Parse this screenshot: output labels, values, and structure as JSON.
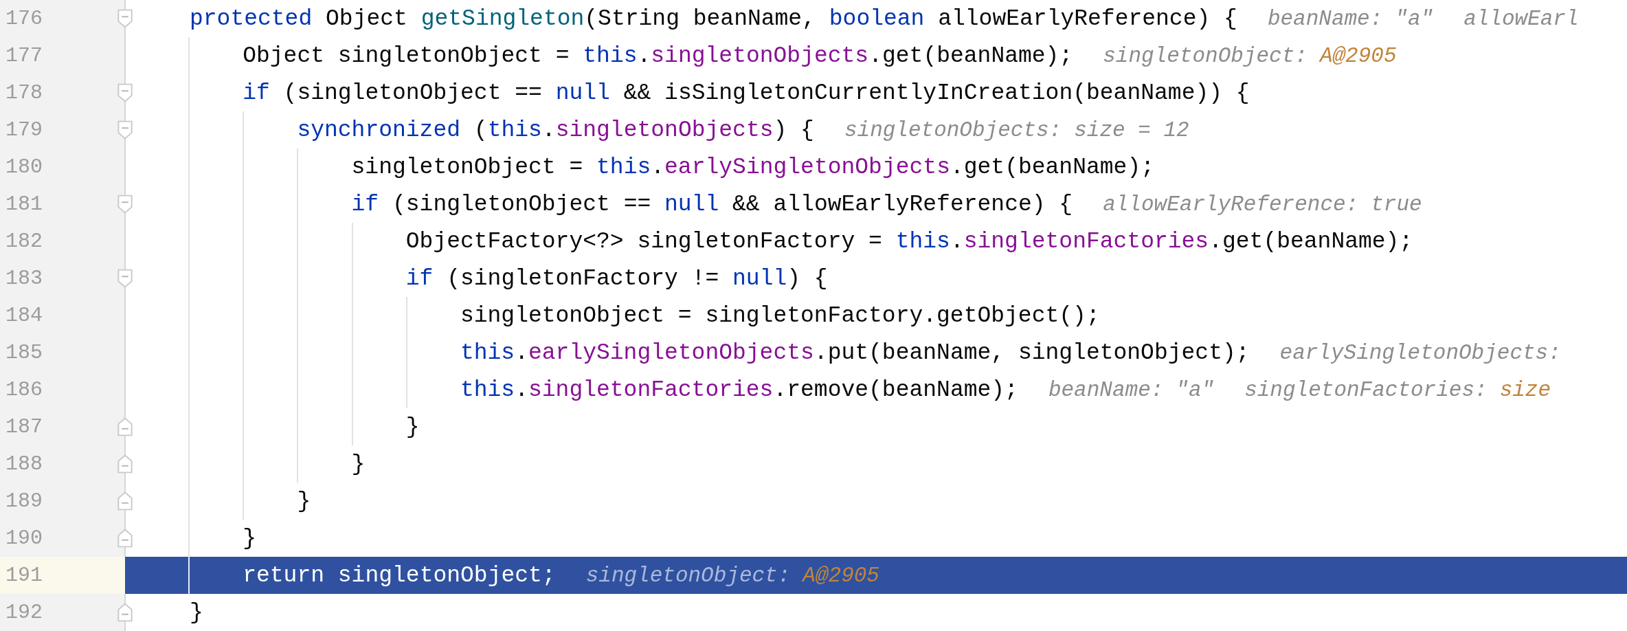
{
  "lines": [
    {
      "number": "176",
      "kind": "block-start",
      "selected": false,
      "tokens": [
        {
          "kind": "keyword",
          "text": "protected"
        },
        {
          "kind": "plain",
          "text": " Object "
        },
        {
          "kind": "method",
          "text": "getSingleton"
        },
        {
          "kind": "plain",
          "text": "(String beanName, "
        },
        {
          "kind": "keyword",
          "text": "boolean"
        },
        {
          "kind": "plain",
          "text": " allowEarlyReference) {"
        }
      ],
      "hints": [
        {
          "label": "beanName:",
          "value": "\"a\"",
          "kind": "plain"
        },
        {
          "label": "allowEarl"
        }
      ],
      "children": [
        {
          "number": "177",
          "kind": "line",
          "selected": false,
          "tokens": [
            {
              "kind": "plain",
              "text": "Object singletonObject = "
            },
            {
              "kind": "keyword",
              "text": "this"
            },
            {
              "kind": "plain",
              "text": "."
            },
            {
              "kind": "field",
              "text": "singletonObjects"
            },
            {
              "kind": "plain",
              "text": ".get(beanName);"
            }
          ],
          "hints": [
            {
              "label": "singletonObject:",
              "value": "A@2905",
              "kind": "object"
            }
          ]
        },
        {
          "number": "178",
          "kind": "block-start",
          "selected": false,
          "tokens": [
            {
              "kind": "keyword",
              "text": "if"
            },
            {
              "kind": "plain",
              "text": " (singletonObject == "
            },
            {
              "kind": "keyword",
              "text": "null"
            },
            {
              "kind": "plain",
              "text": " && isSingletonCurrentlyInCreation(beanName)) {"
            }
          ],
          "children": [
            {
              "number": "179",
              "kind": "block-start",
              "selected": false,
              "tokens": [
                {
                  "kind": "keyword",
                  "text": "synchronized"
                },
                {
                  "kind": "plain",
                  "text": " ("
                },
                {
                  "kind": "keyword",
                  "text": "this"
                },
                {
                  "kind": "plain",
                  "text": "."
                },
                {
                  "kind": "field",
                  "text": "singletonObjects"
                },
                {
                  "kind": "plain",
                  "text": ") {"
                }
              ],
              "hints": [
                {
                  "label": "singletonObjects:",
                  "value": "size = 12",
                  "kind": "plain"
                }
              ],
              "children": [
                {
                  "number": "180",
                  "kind": "line",
                  "selected": false,
                  "tokens": [
                    {
                      "kind": "plain",
                      "text": "singletonObject = "
                    },
                    {
                      "kind": "keyword",
                      "text": "this"
                    },
                    {
                      "kind": "plain",
                      "text": "."
                    },
                    {
                      "kind": "field",
                      "text": "earlySingletonObjects"
                    },
                    {
                      "kind": "plain",
                      "text": ".get(beanName);"
                    }
                  ]
                },
                {
                  "number": "181",
                  "kind": "block-start",
                  "selected": false,
                  "tokens": [
                    {
                      "kind": "keyword",
                      "text": "if"
                    },
                    {
                      "kind": "plain",
                      "text": " (singletonObject == "
                    },
                    {
                      "kind": "keyword",
                      "text": "null"
                    },
                    {
                      "kind": "plain",
                      "text": " && allowEarlyReference) {"
                    }
                  ],
                  "hints": [
                    {
                      "label": "allowEarlyReference:",
                      "value": "true",
                      "kind": "plain"
                    }
                  ],
                  "children": [
                    {
                      "number": "182",
                      "kind": "line",
                      "selected": false,
                      "tokens": [
                        {
                          "kind": "plain",
                          "text": "ObjectFactory<?> singletonFactory = "
                        },
                        {
                          "kind": "keyword",
                          "text": "this"
                        },
                        {
                          "kind": "plain",
                          "text": "."
                        },
                        {
                          "kind": "field",
                          "text": "singletonFactories"
                        },
                        {
                          "kind": "plain",
                          "text": ".get(beanName);"
                        }
                      ]
                    },
                    {
                      "number": "183",
                      "kind": "block-start",
                      "selected": false,
                      "tokens": [
                        {
                          "kind": "keyword",
                          "text": "if"
                        },
                        {
                          "kind": "plain",
                          "text": " (singletonFactory != "
                        },
                        {
                          "kind": "keyword",
                          "text": "null"
                        },
                        {
                          "kind": "plain",
                          "text": ") {"
                        }
                      ],
                      "children": [
                        {
                          "number": "184",
                          "kind": "line",
                          "selected": false,
                          "tokens": [
                            {
                              "kind": "plain",
                              "text": "singletonObject = singletonFactory.getObject();"
                            }
                          ]
                        },
                        {
                          "number": "185",
                          "kind": "line",
                          "selected": false,
                          "tokens": [
                            {
                              "kind": "keyword",
                              "text": "this"
                            },
                            {
                              "kind": "plain",
                              "text": "."
                            },
                            {
                              "kind": "field",
                              "text": "earlySingletonObjects"
                            },
                            {
                              "kind": "plain",
                              "text": ".put(beanName, singletonObject);"
                            }
                          ],
                          "hints": [
                            {
                              "label": "earlySingletonObjects:"
                            }
                          ]
                        },
                        {
                          "number": "186",
                          "kind": "line",
                          "selected": false,
                          "tokens": [
                            {
                              "kind": "keyword",
                              "text": "this"
                            },
                            {
                              "kind": "plain",
                              "text": "."
                            },
                            {
                              "kind": "field",
                              "text": "singletonFactories"
                            },
                            {
                              "kind": "plain",
                              "text": ".remove(beanName);"
                            }
                          ],
                          "hints": [
                            {
                              "label": "beanName:",
                              "value": "\"a\"",
                              "kind": "plain"
                            },
                            {
                              "label": "singletonFactories:",
                              "value": "size",
                              "kind": "object"
                            }
                          ]
                        }
                      ]
                    },
                    {
                      "number": "187",
                      "kind": "block-end",
                      "selected": false,
                      "tokens": [
                        {
                          "kind": "plain",
                          "text": "}"
                        }
                      ]
                    }
                  ]
                },
                {
                  "number": "188",
                  "kind": "block-end",
                  "selected": false,
                  "tokens": [
                    {
                      "kind": "plain",
                      "text": "}"
                    }
                  ]
                }
              ]
            },
            {
              "number": "189",
              "kind": "block-end",
              "selected": false,
              "tokens": [
                {
                  "kind": "plain",
                  "text": "}"
                }
              ]
            }
          ]
        },
        {
          "number": "190",
          "kind": "block-end",
          "selected": false,
          "tokens": [
            {
              "kind": "plain",
              "text": "}"
            }
          ]
        },
        {
          "number": "191",
          "kind": "line",
          "selected": true,
          "tokens": [
            {
              "kind": "keyword",
              "text": "return"
            },
            {
              "kind": "plain",
              "text": " singletonObject;"
            }
          ],
          "hints": [
            {
              "label": "singletonObject:",
              "value": "A@2905",
              "kind": "object"
            }
          ]
        }
      ]
    },
    {
      "number": "192",
      "kind": "block-end",
      "selected": false,
      "tokens": [
        {
          "kind": "plain",
          "text": "}"
        }
      ]
    }
  ]
}
